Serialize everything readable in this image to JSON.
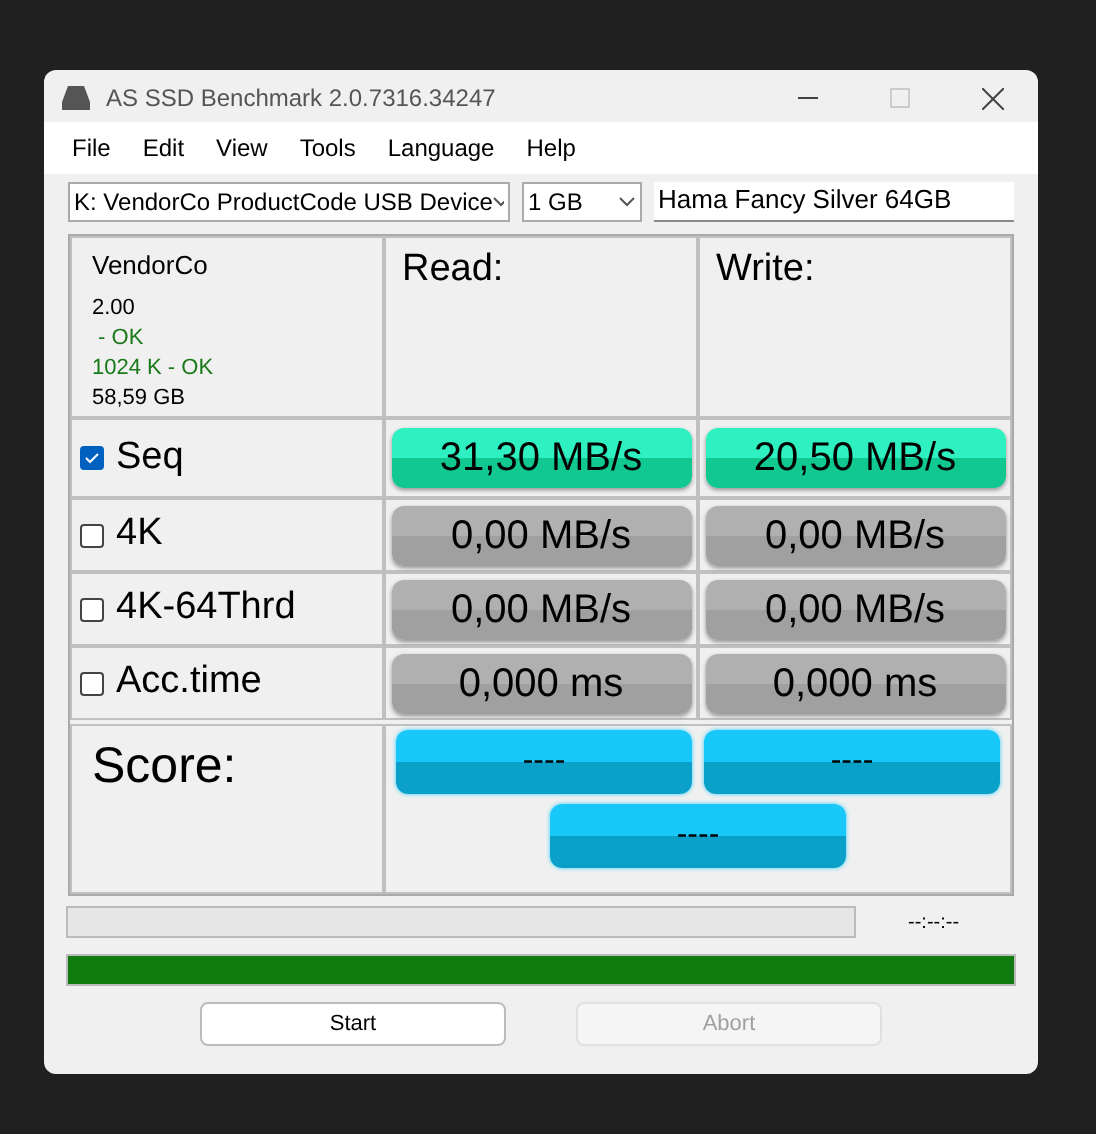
{
  "window": {
    "title": "AS SSD Benchmark 2.0.7316.34247"
  },
  "menu": [
    "File",
    "Edit",
    "View",
    "Tools",
    "Language",
    "Help"
  ],
  "drive_select": {
    "value": "K: VendorCo ProductCode USB Device"
  },
  "size_select": {
    "value": "1 GB"
  },
  "name_field": {
    "value": "Hama Fancy Silver 64GB"
  },
  "info": {
    "vendor": "VendorCo",
    "lines": [
      {
        "text": "2.00",
        "kind": "plain"
      },
      {
        "text": " - OK",
        "kind": "ok"
      },
      {
        "text": "1024 K - OK",
        "kind": "ok"
      },
      {
        "text": "58,59 GB",
        "kind": "plain"
      }
    ]
  },
  "columns": [
    "Read:",
    "Write:"
  ],
  "rows": [
    {
      "label": "Seq",
      "checked": true,
      "read": {
        "text": "31,30 MB/s",
        "kind": "done"
      },
      "write": {
        "text": "20,50 MB/s",
        "kind": "done"
      }
    },
    {
      "label": "4K",
      "checked": false,
      "read": {
        "text": "0,00 MB/s",
        "kind": "idle"
      },
      "write": {
        "text": "0,00 MB/s",
        "kind": "idle"
      }
    },
    {
      "label": "4K-64Thrd",
      "checked": false,
      "read": {
        "text": "0,00 MB/s",
        "kind": "idle"
      },
      "write": {
        "text": "0,00 MB/s",
        "kind": "idle"
      }
    },
    {
      "label": "Acc.time",
      "checked": false,
      "read": {
        "text": "0,000 ms",
        "kind": "idle"
      },
      "write": {
        "text": "0,000 ms",
        "kind": "idle"
      }
    }
  ],
  "score": {
    "label": "Score:",
    "read": "----",
    "write": "----",
    "total": "----"
  },
  "progress": {
    "level": 0,
    "time": "--:--:--"
  },
  "total_progress": {
    "level": 1
  },
  "buttons": [
    {
      "label": "Start",
      "disabled": false
    },
    {
      "label": "Abort",
      "disabled": true
    }
  ]
}
